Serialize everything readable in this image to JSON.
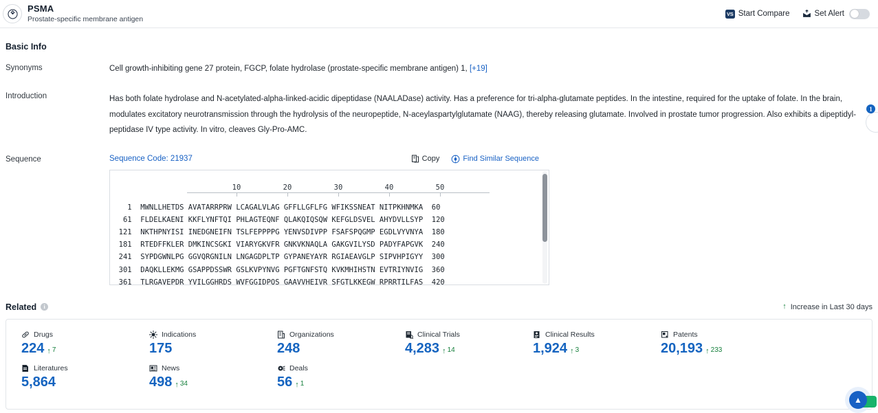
{
  "header": {
    "logo_icon": "target-diamond-icon",
    "title": "PSMA",
    "subtitle": "Prostate-specific membrane antigen",
    "start_compare_label": "Start Compare",
    "start_compare_icon": "vs-icon",
    "vs_badge_text": "VS",
    "set_alert_label": "Set Alert",
    "set_alert_icon": "alert-bell-icon",
    "alert_toggle_state": "off"
  },
  "basic_info": {
    "section_title": "Basic Info",
    "synonyms": {
      "label": "Synonyms",
      "value": "Cell growth-inhibiting gene 27 protein,  FGCP,  folate hydrolase (prostate-specific membrane antigen) 1,",
      "more_label": "[+19]"
    },
    "introduction": {
      "label": "Introduction",
      "value": "Has both folate hydrolase and N-acetylated-alpha-linked-acidic dipeptidase (NAALADase) activity. Has a preference for tri-alpha-glutamate peptides. In the intestine, required for the uptake of folate. In the brain, modulates excitatory neurotransmission through the hydrolysis of the neuropeptide, N-aceylaspartylglutamate (NAAG), thereby releasing glutamate. Involved in prostate tumor progression. Also exhibits a dipeptidyl-peptidase IV type activity. In vitro, cleaves Gly-Pro-AMC."
    },
    "sequence": {
      "label": "Sequence",
      "code_label": "Sequence Code: 21937",
      "copy_label": "Copy",
      "copy_icon": "copy-icon",
      "find_similar_label": "Find Similar Sequence",
      "find_similar_icon": "find-similar-icon",
      "ruler_ticks": [
        10,
        20,
        30,
        40,
        50
      ],
      "lines": [
        {
          "start": "1",
          "residues": "MWNLLHETDS AVATARRPRW LCAGALVLAG GFFLLGFLFG WFIKSSNEAT NITPKHNMKA",
          "end": "60"
        },
        {
          "start": "61",
          "residues": "FLDELKAENI KKFLYNFTQI PHLAGTEQNF QLAKQIQSQW KEFGLDSVEL AHYDVLLSYP",
          "end": "120"
        },
        {
          "start": "121",
          "residues": "NKTHPNYISI INEDGNEIFN TSLFEPPPPG YENVSDIVPP FSAFSPQGMP EGDLVYVNYA",
          "end": "180"
        },
        {
          "start": "181",
          "residues": "RTEDFFKLER DMKINCSGKI VIARYGKVFR GNKVKNAQLA GAKGVILYSD PADYFAPGVK",
          "end": "240"
        },
        {
          "start": "241",
          "residues": "SYPDGWNLPG GGVQRGNILN LNGAGDPLTP GYPANEYAYR RGIAEAVGLP SIPVHPIGYY",
          "end": "300"
        },
        {
          "start": "301",
          "residues": "DAQKLLEKMG GSAPPDSSWR GSLKVPYNVG PGFTGNFSTQ KVKMHIHSTN EVTRIYNVIG",
          "end": "360"
        },
        {
          "start": "361",
          "residues": "TLRGAVEPDR YVILGGHRDS WVFGGIDPQS GAAVVHEIVR SFGTLKKEGW RPRRTILFAS",
          "end": "420"
        }
      ]
    }
  },
  "related": {
    "title": "Related",
    "info_icon": "info-icon",
    "legend_label": "Increase in Last 30 days",
    "legend_icon": "up-arrow-icon",
    "stats": [
      {
        "label": "Drugs",
        "icon": "pill-icon",
        "value": "224",
        "delta": "7"
      },
      {
        "label": "Indications",
        "icon": "virus-icon",
        "value": "175",
        "delta": ""
      },
      {
        "label": "Organizations",
        "icon": "building-icon",
        "value": "248",
        "delta": ""
      },
      {
        "label": "Clinical Trials",
        "icon": "clinical-trial-icon",
        "value": "4,283",
        "delta": "14"
      },
      {
        "label": "Clinical Results",
        "icon": "clinical-result-icon",
        "value": "1,924",
        "delta": "3"
      },
      {
        "label": "Patents",
        "icon": "patent-icon",
        "value": "20,193",
        "delta": "233"
      },
      {
        "label": "Literatures",
        "icon": "literature-icon",
        "value": "5,864",
        "delta": ""
      },
      {
        "label": "News",
        "icon": "news-icon",
        "value": "498",
        "delta": "34"
      },
      {
        "label": "Deals",
        "icon": "deals-icon",
        "value": "56",
        "delta": "1"
      }
    ]
  },
  "floating": {
    "side_badge_count": "1",
    "side_widget_icon": "chat-circle-icon",
    "fab_icon": "blue-arrow-icon",
    "fab_secondary_icon": "green-chat-icon"
  },
  "colors": {
    "accent_blue": "#1564c0",
    "link_blue": "#1861c4",
    "increase_green": "#17803d",
    "dark_navy": "#1b3a63"
  }
}
